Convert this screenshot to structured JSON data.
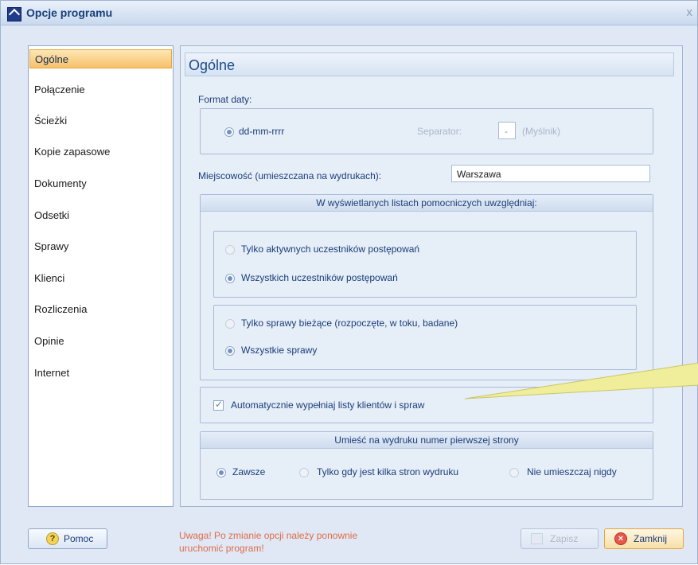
{
  "window": {
    "title": "Opcje programu",
    "close_glyph": "x"
  },
  "sidebar": {
    "items": [
      {
        "label": "Ogólne",
        "active": true
      },
      {
        "label": "Połączenie"
      },
      {
        "label": "Ścieżki"
      },
      {
        "label": "Kopie zapasowe"
      },
      {
        "label": "Dokumenty"
      },
      {
        "label": "Odsetki"
      },
      {
        "label": "Sprawy"
      },
      {
        "label": "Klienci"
      },
      {
        "label": "Rozliczenia"
      },
      {
        "label": "Opinie"
      },
      {
        "label": "Internet"
      }
    ]
  },
  "main": {
    "title": "Ogólne",
    "date_format": {
      "label": "Format daty:",
      "option": "dd-mm-rrrr",
      "separator_label": "Separator:",
      "separator_value": "-",
      "separator_hint": "(Myślnik)"
    },
    "city": {
      "label": "Miejscowość (umieszczana na wydrukach):",
      "value": "Warszawa"
    },
    "lists_group": {
      "header": "W wyświetlanych listach pomocniczych uwzględniaj:",
      "participants": [
        "Tylko aktywnych uczestników postępowań",
        "Wszystkich uczestników postępowań"
      ],
      "cases": [
        "Tylko sprawy bieżące (rozpoczęte, w toku, badane)",
        "Wszystkie sprawy"
      ]
    },
    "autofill": {
      "label": "Automatycznie wypełniaj listy klientów i spraw",
      "checked": true
    },
    "page_number": {
      "header": "Umieść na wydruku numer pierwszej strony",
      "options": [
        "Zawsze",
        "Tylko gdy jest kilka stron wydruku",
        "Nie umieszczaj nigdy"
      ]
    }
  },
  "footer": {
    "help_label": "Pomoc",
    "warning": "Uwaga! Po zmianie opcji należy ponownie uruchomić program!",
    "save_label": "Zapisz",
    "close_label": "Zamknij"
  },
  "colors": {
    "accent": "#f7c16a",
    "title": "#1a3f7a",
    "warning": "#e06b4a",
    "callout": "#e8e37a"
  }
}
